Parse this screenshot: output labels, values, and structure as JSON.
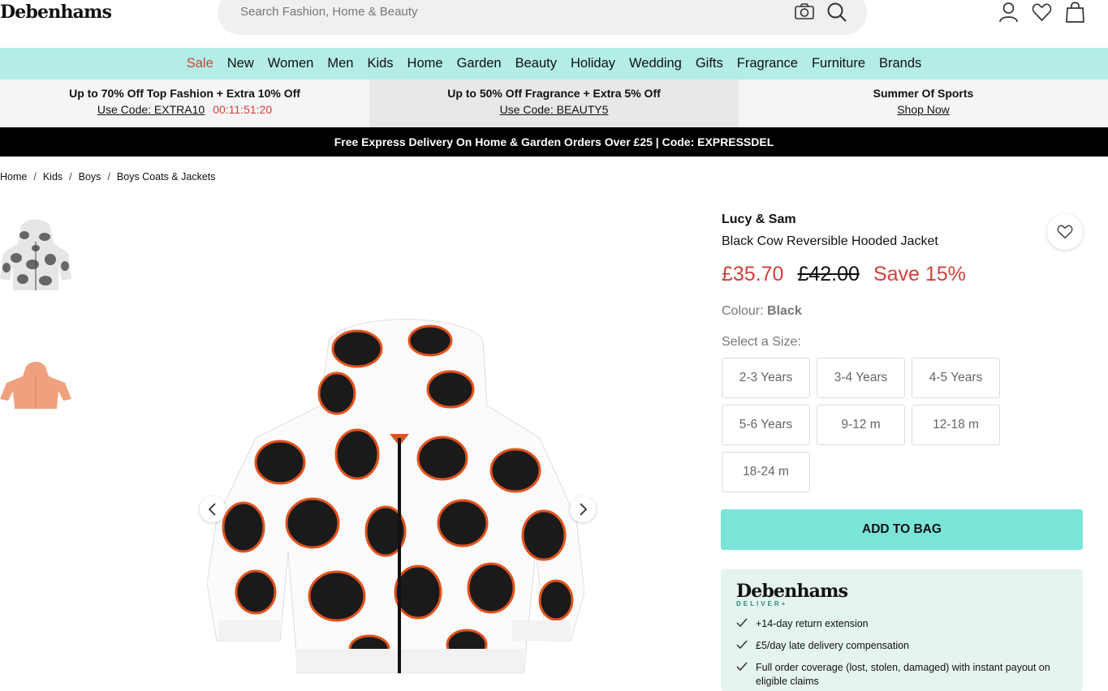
{
  "header": {
    "logo": "Debenhams",
    "search_placeholder": "Search Fashion, Home & Beauty"
  },
  "nav": [
    "Sale",
    "New",
    "Women",
    "Men",
    "Kids",
    "Home",
    "Garden",
    "Beauty",
    "Holiday",
    "Wedding",
    "Gifts",
    "Fragrance",
    "Furniture",
    "Brands"
  ],
  "promos": [
    {
      "title": "Up to 70% Off Top Fashion + Extra 10% Off",
      "link": "Use Code: EXTRA10",
      "countdown": "00:11:51:20"
    },
    {
      "title": "Up to 50% Off Fragrance + Extra 5% Off",
      "link": "Use Code: BEAUTY5"
    },
    {
      "title": "Summer Of Sports",
      "link": "Shop Now"
    }
  ],
  "delivery_banner": "Free Express Delivery On Home & Garden Orders Over £25 | Code: EXPRESSDEL",
  "breadcrumb": [
    "Home",
    "Kids",
    "Boys",
    "Boys Coats & Jackets"
  ],
  "product": {
    "brand": "Lucy & Sam",
    "name": "Black Cow Reversible Hooded Jacket",
    "price": "£35.70",
    "was_price": "£42.00",
    "save": "Save 15%",
    "colour_label": "Colour:",
    "colour_value": "Black",
    "size_label": "Select a Size:",
    "sizes": [
      "2-3 Years",
      "3-4 Years",
      "4-5 Years",
      "5-6 Years",
      "9-12 m",
      "12-18 m",
      "18-24 m"
    ],
    "add_to_bag": "ADD TO BAG"
  },
  "deliver_plus": {
    "logo": "Debenhams",
    "sub": "DELIVER+",
    "items": [
      "+14-day return extension",
      "£5/day late delivery compensation",
      "Full order coverage (lost, stolen, damaged) with instant payout on eligible claims"
    ]
  },
  "colors": {
    "accent": "#7be4d8",
    "nav_bg": "#b3ede6",
    "sale": "#d0413b"
  }
}
